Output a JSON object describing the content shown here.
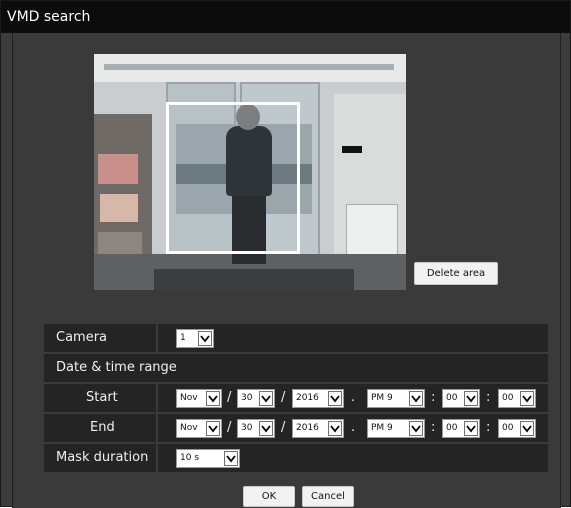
{
  "window": {
    "title": "VMD search"
  },
  "image_area": {
    "delete_area_label": "Delete area"
  },
  "form": {
    "camera": {
      "label": "Camera",
      "value": "1"
    },
    "range_header": "Date & time range",
    "start": {
      "label": "Start",
      "month": "Nov",
      "day": "30",
      "year": "2016",
      "hour": "PM 9",
      "minute": "00",
      "second": "00"
    },
    "end": {
      "label": "End",
      "month": "Nov",
      "day": "30",
      "year": "2016",
      "hour": "PM 9",
      "minute": "00",
      "second": "00"
    },
    "mask_duration": {
      "label": "Mask duration",
      "value": "10 s"
    },
    "separators": {
      "date": "/",
      "time": ":",
      "dot": "."
    }
  },
  "actions": {
    "ok_label": "OK",
    "cancel_label": "Cancel"
  }
}
